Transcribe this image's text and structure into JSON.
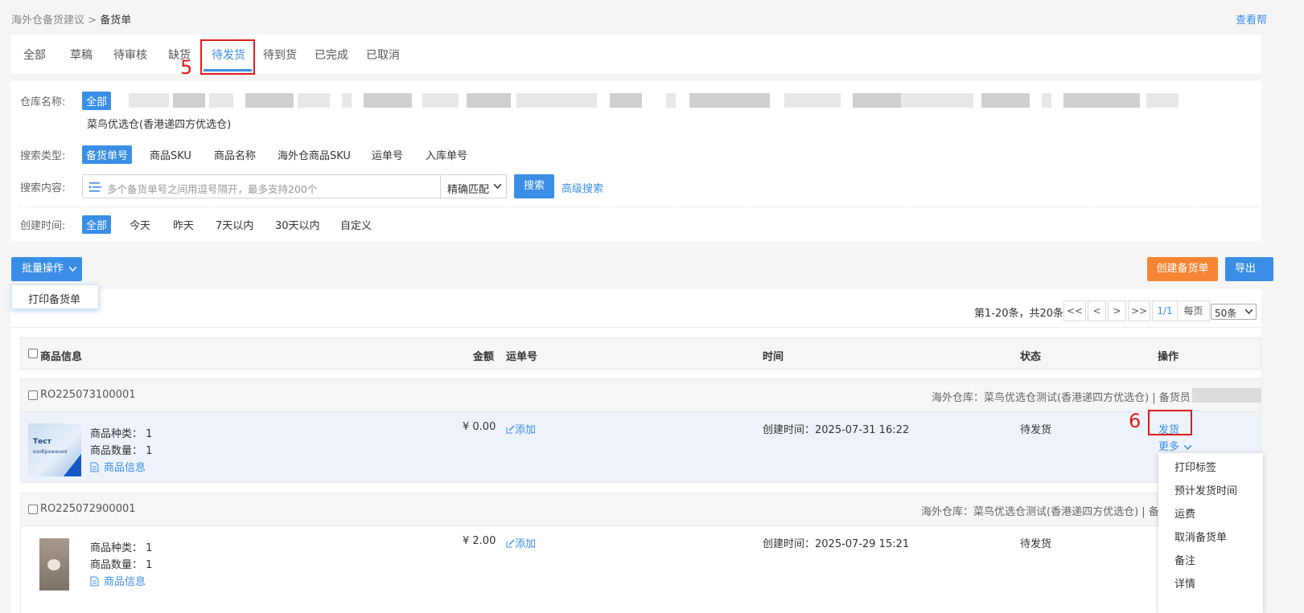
{
  "breadcrumb": {
    "parent": "海外仓备货建议",
    "sep": ">",
    "current": "备货单"
  },
  "help_link": "查看帮",
  "tabs": [
    {
      "label": "全部"
    },
    {
      "label": "草稿"
    },
    {
      "label": "待审核"
    },
    {
      "label": "缺货"
    },
    {
      "label": "待发货"
    },
    {
      "label": "待到货"
    },
    {
      "label": "已完成"
    },
    {
      "label": "已取消"
    }
  ],
  "annotations": {
    "step5": "5",
    "step6": "6"
  },
  "filters": {
    "warehouse_label": "仓库名称:",
    "warehouse_all": "全部",
    "warehouse_option": "菜鸟优选仓(香港递四方优选仓)",
    "search_type_label": "搜索类型:",
    "search_types": [
      "备货单号",
      "商品SKU",
      "商品名称",
      "海外仓商品SKU",
      "运单号",
      "入库单号"
    ],
    "search_content_label": "搜索内容:",
    "search_placeholder": "多个备货单号之间用逗号隔开，最多支持200个",
    "match_mode": "精确匹配",
    "search_button": "搜索",
    "advanced_search": "高级搜索",
    "created_label": "创建时间:",
    "created_options": [
      "全部",
      "今天",
      "昨天",
      "7天以内",
      "30天以内",
      "自定义"
    ]
  },
  "toolbar": {
    "batch_label": "批量操作",
    "batch_menu_item": "打印备货单",
    "create_label": "创建备货单",
    "export_label": "导出"
  },
  "pager": {
    "summary": "第1-20条，共20条",
    "first": "<<",
    "prev": "<",
    "next": ">",
    "last": ">>",
    "page": "1/1",
    "per_page_label": "每页",
    "per_page_value": "50条"
  },
  "table_headers": {
    "product": "商品信息",
    "amount": "金额",
    "waybill": "运单号",
    "time": "时间",
    "status": "状态",
    "action": "操作"
  },
  "orders": [
    {
      "order_no": "RO225073100001",
      "warehouse_info": "海外仓库：菜鸟优选仓测试(香港递四方优选仓) | 备货员：",
      "kinds": "商品种类：  1",
      "qty": "商品数量：  1",
      "product_link": "商品信息",
      "amount": "¥ 0.00",
      "waybill_add": "添加",
      "created": "创建时间：2025-07-31 16:22",
      "status": "待发货",
      "action_ship": "发货",
      "action_more": "更多"
    },
    {
      "order_no": "RO225072900001",
      "warehouse_info": "海外仓库：菜鸟优选仓测试(香港递四方优选仓) | 备货",
      "kinds": "商品种类：  1",
      "qty": "商品数量：  1",
      "product_link": "商品信息",
      "amount": "¥ 2.00",
      "waybill_add": "添加",
      "created": "创建时间：2025-07-29 15:21",
      "status": "待发货"
    }
  ],
  "more_menu": [
    "打印标签",
    "预计发货时间",
    "运费",
    "取消备货单",
    "备注",
    "详情"
  ],
  "image_text": {
    "label": "Тест",
    "sub": "изображения"
  },
  "colors": {
    "accent": "#3a8ee6",
    "orange": "#f58533",
    "annotation_red": "#e01b1b"
  }
}
